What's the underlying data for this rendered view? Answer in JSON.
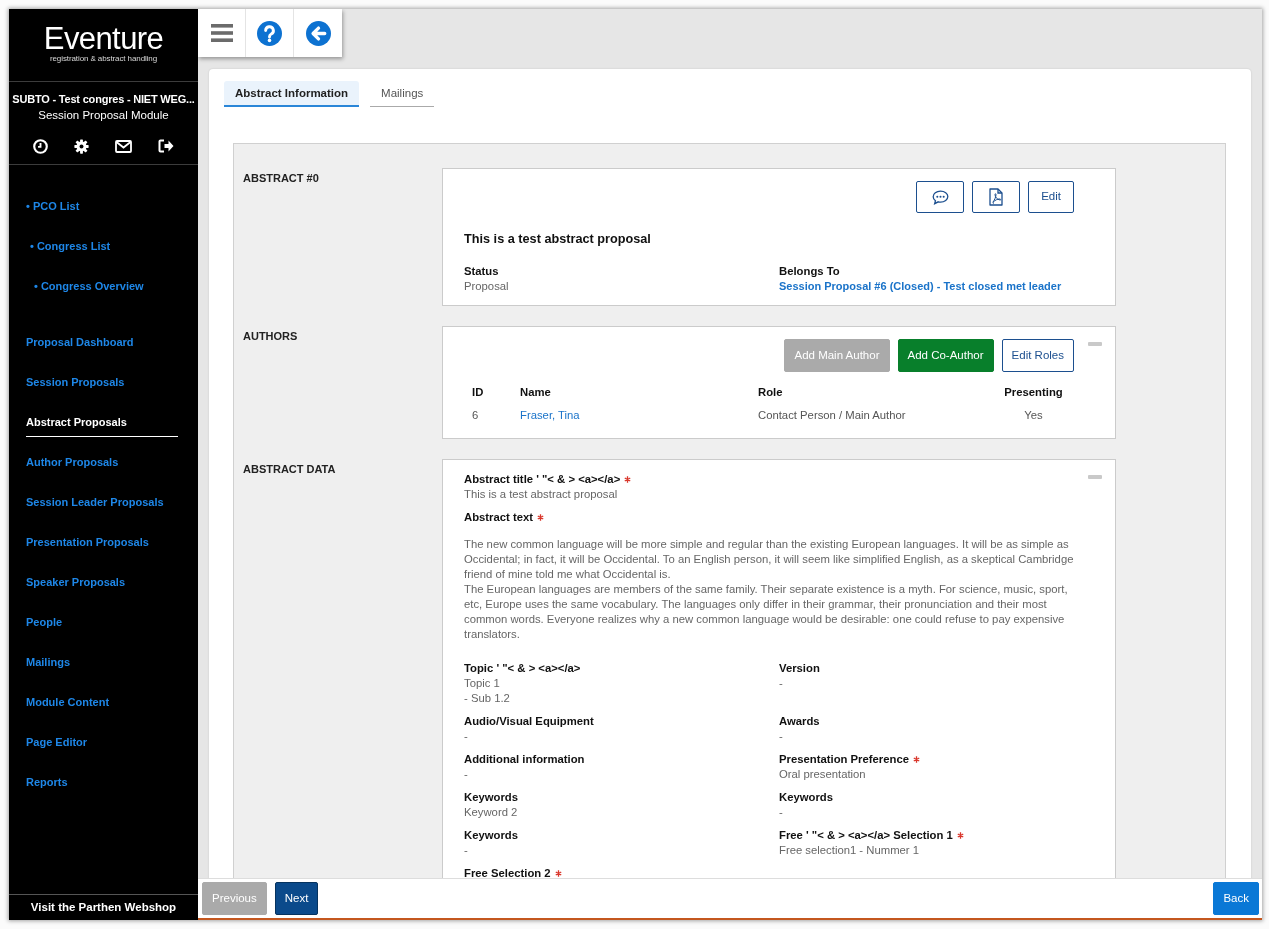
{
  "sidebar": {
    "logo": {
      "name": "Eventure",
      "tagline": "registration & abstract handling"
    },
    "congress": "SUBTO - Test congres - NIET WEG...",
    "module": "Session Proposal Module",
    "breadcrumb": [
      {
        "label": "• PCO List",
        "children": [
          {
            "label": "• Congress List",
            "children": [
              {
                "label": "• Congress Overview"
              }
            ]
          }
        ]
      }
    ],
    "items": [
      {
        "label": "Proposal Dashboard",
        "selected": false
      },
      {
        "label": "Session Proposals",
        "selected": false
      },
      {
        "label": "Abstract Proposals",
        "selected": true
      },
      {
        "label": "Author Proposals",
        "selected": false
      },
      {
        "label": "Session Leader Proposals",
        "selected": false
      },
      {
        "label": "Presentation Proposals",
        "selected": false
      },
      {
        "label": "Speaker Proposals",
        "selected": false
      },
      {
        "label": "People",
        "selected": false
      },
      {
        "label": "Mailings",
        "selected": false
      },
      {
        "label": "Module Content",
        "selected": false
      },
      {
        "label": "Page Editor",
        "selected": false
      },
      {
        "label": "Reports",
        "selected": false
      }
    ],
    "footer_link": "Visit the Parthen Webshop"
  },
  "tabs": [
    {
      "label": "Abstract Information",
      "selected": true
    },
    {
      "label": "Mailings",
      "selected": false
    }
  ],
  "sections": [
    {
      "kind": "summary",
      "label": "ABSTRACT #0",
      "collapsible": false,
      "edit_button": "Edit",
      "title": "This is a test abstract proposal",
      "fields": [
        {
          "label": "Status",
          "value": "Proposal",
          "kind": "text"
        },
        {
          "label": "Belongs To",
          "value": "Session Proposal #6 (Closed) - Test closed met leader",
          "kind": "link"
        }
      ]
    },
    {
      "kind": "authors",
      "label": "AUTHORS",
      "collapsible": true,
      "buttons": [
        {
          "label": "Add Main Author",
          "kind": "add",
          "disabled": true
        },
        {
          "label": "Add Co-Author",
          "kind": "add",
          "disabled": false
        },
        {
          "label": "Edit Roles",
          "kind": "outline",
          "disabled": false
        }
      ],
      "table": {
        "columns": [
          {
            "label": "ID",
            "kind": "text"
          },
          {
            "label": "Name",
            "kind": "link"
          },
          {
            "label": "Role",
            "kind": "text"
          },
          {
            "label": "Presenting",
            "kind": "center"
          }
        ],
        "rows": [
          [
            "6",
            "Fraser, Tina",
            "Contact Person / Main Author",
            "Yes"
          ]
        ]
      }
    },
    {
      "kind": "data",
      "label": "ABSTRACT DATA",
      "collapsible": true,
      "fields": [
        {
          "label": "Abstract title ' \"< & > <a></a>",
          "required": true,
          "kind": "wide",
          "values": [
            "This is a test abstract proposal"
          ]
        },
        {
          "label": "Abstract text",
          "required": true,
          "kind": "text",
          "values": [
            "The new common language will be more simple and regular than the existing European languages. It will be as simple as Occidental; in fact, it will be Occidental. To an English person, it will seem like simplified English, as a skeptical Cambridge friend of mine told me what Occidental is.",
            "The European languages are members of the same family. Their separate existence is a myth. For science, music, sport, etc, Europe uses the same vocabulary. The languages only differ in their grammar, their pronunciation and their most common words. Everyone realizes why a new common language would be desirable: one could refuse to pay expensive translators."
          ]
        },
        {
          "label": "Topic ' \"< & > <a></a>",
          "required": false,
          "kind": "half",
          "values": [
            "Topic 1",
            "- Sub 1.2"
          ]
        },
        {
          "label": "Version",
          "required": false,
          "kind": "half",
          "values": [
            "-"
          ]
        },
        {
          "label": "Audio/Visual Equipment",
          "required": false,
          "kind": "half",
          "values": [
            "-"
          ]
        },
        {
          "label": "Awards",
          "required": false,
          "kind": "half",
          "values": [
            "-"
          ]
        },
        {
          "label": "Additional information",
          "required": false,
          "kind": "half",
          "values": [
            "-"
          ]
        },
        {
          "label": "Presentation Preference",
          "required": true,
          "kind": "half",
          "values": [
            "Oral presentation"
          ]
        },
        {
          "label": "Keywords",
          "required": false,
          "kind": "half",
          "values": [
            "Keyword 2"
          ]
        },
        {
          "label": "Keywords",
          "required": false,
          "kind": "half",
          "values": [
            "-"
          ]
        },
        {
          "label": "Keywords",
          "required": false,
          "kind": "half",
          "values": [
            "-"
          ]
        },
        {
          "label": "Free ' \"< & > <a></a> Selection 1",
          "required": true,
          "kind": "half",
          "values": [
            "Free selection1 - Nummer 1"
          ]
        },
        {
          "label": "Free Selection 2",
          "required": true,
          "kind": "half"
        }
      ]
    }
  ],
  "footer": {
    "buttons": [
      {
        "label": "Previous",
        "kind": "step",
        "disabled": true
      },
      {
        "label": "Next",
        "kind": "step",
        "disabled": false
      },
      {
        "label": "Back",
        "kind": "back",
        "disabled": false
      }
    ]
  }
}
